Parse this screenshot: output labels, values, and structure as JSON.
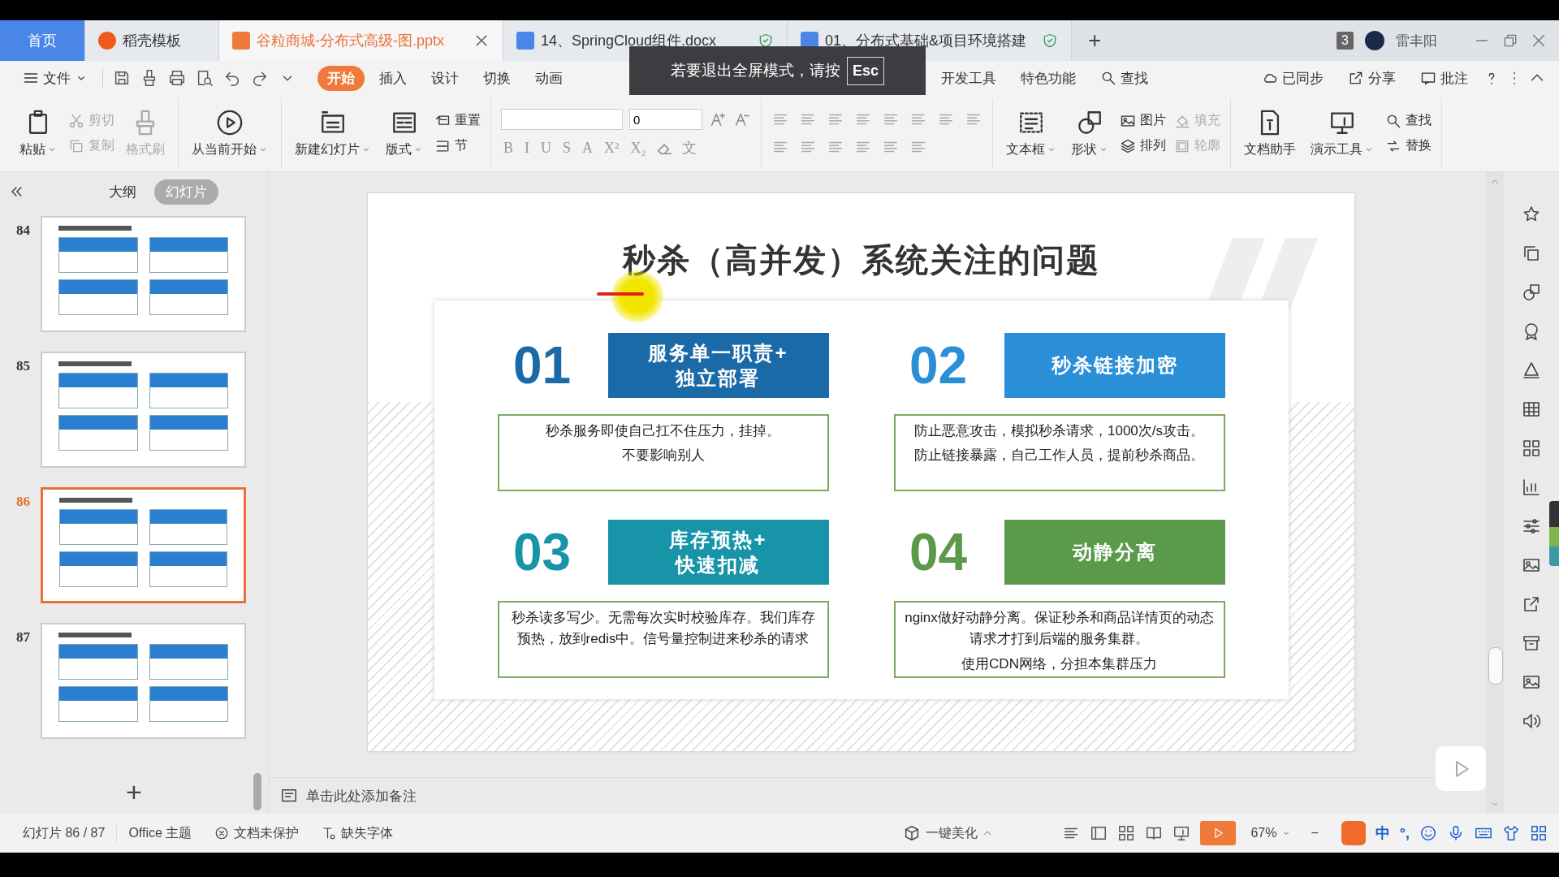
{
  "tabs": [
    {
      "label": "首页",
      "kind": "home",
      "selected": false
    },
    {
      "label": "稻壳模板",
      "kind": "docer",
      "selected": false
    },
    {
      "label": "谷粒商城-分布式高级-图.pptx",
      "kind": "ppt",
      "selected": true
    },
    {
      "label": "14、SpringCloud组件.docx",
      "kind": "word",
      "selected": false
    },
    {
      "label": "01、分布式基础&项目环境搭建",
      "kind": "word",
      "selected": false
    }
  ],
  "new_tab": "+",
  "window_count": "3",
  "user": "雷丰阳",
  "menu": {
    "file": "文件",
    "items": [
      {
        "label": "开始",
        "selected": true
      },
      {
        "label": "插入",
        "selected": false
      },
      {
        "label": "设计",
        "selected": false
      },
      {
        "label": "切换",
        "selected": false
      },
      {
        "label": "动画",
        "selected": false
      }
    ],
    "items_after": [
      {
        "label": "开发工具",
        "selected": false
      },
      {
        "label": "特色功能",
        "selected": false
      }
    ],
    "search": "查找",
    "actions": [
      "已同步",
      "分享",
      "批注"
    ]
  },
  "toast": {
    "text": "若要退出全屏模式，请按",
    "key": "Esc"
  },
  "ribbon": {
    "groups": [
      [
        {
          "kind": "large",
          "label": "粘贴",
          "dropdown": true,
          "disabled": false
        },
        {
          "kind": "stack",
          "items": [
            {
              "label": "剪切",
              "disabled": true
            },
            {
              "label": "复制",
              "disabled": true
            }
          ]
        },
        {
          "kind": "large",
          "label": "格式刷",
          "dropdown": false,
          "disabled": true
        }
      ],
      [
        {
          "kind": "large",
          "label": "从当前开始",
          "dropdown": true,
          "disabled": false
        }
      ],
      [
        {
          "kind": "large",
          "label": "新建幻灯片",
          "dropdown": true,
          "disabled": false
        },
        {
          "kind": "large",
          "label": "版式",
          "dropdown": true,
          "disabled": false
        },
        {
          "kind": "stack",
          "items": [
            {
              "label": "重置",
              "disabled": false
            },
            {
              "label": "节",
              "disabled": false
            }
          ]
        }
      ],
      [
        {
          "kind": "font",
          "size_value": "0",
          "format_buttons": [
            "B",
            "I",
            "U",
            "S",
            "A",
            "X²",
            "X₂",
            "文"
          ]
        }
      ],
      [
        {
          "kind": "paragraph"
        }
      ],
      [
        {
          "kind": "large",
          "label": "文本框",
          "dropdown": true,
          "disabled": false
        },
        {
          "kind": "large",
          "label": "形状",
          "dropdown": true,
          "disabled": false
        },
        {
          "kind": "stack",
          "items": [
            {
              "label": "图片",
              "disabled": false
            },
            {
              "label": "排列",
              "disabled": false
            }
          ]
        },
        {
          "kind": "stack",
          "items": [
            {
              "label": "填充",
              "disabled": true
            },
            {
              "label": "轮廓",
              "disabled": true
            }
          ]
        }
      ],
      [
        {
          "kind": "large",
          "label": "文档助手",
          "dropdown": false,
          "disabled": false
        },
        {
          "kind": "large",
          "label": "演示工具",
          "dropdown": true,
          "disabled": false
        },
        {
          "kind": "stack",
          "items": [
            {
              "label": "查找",
              "disabled": false
            },
            {
              "label": "替换",
              "disabled": false
            }
          ]
        }
      ]
    ]
  },
  "panel": {
    "views": [
      {
        "label": "大纲",
        "selected": false
      },
      {
        "label": "幻灯片",
        "selected": true
      }
    ],
    "slides": [
      {
        "number": "84",
        "selected": false
      },
      {
        "number": "85",
        "selected": false
      },
      {
        "number": "86",
        "selected": true
      },
      {
        "number": "87",
        "selected": false
      }
    ],
    "add": "+"
  },
  "slide": {
    "title": "秒杀（高并发）系统关注的问题",
    "cards": [
      {
        "number": "01",
        "heading": "服务单一职责+\n独立部署",
        "color": "#1b6aa8",
        "body": [
          "秒杀服务即使自己扛不住压力，挂掉。",
          "不要影响别人"
        ]
      },
      {
        "number": "02",
        "heading": "秒杀链接加密",
        "color": "#2b8fd8",
        "body": [
          "防止恶意攻击，模拟秒杀请求，1000次/s攻击。",
          "防止链接暴露，自己工作人员，提前秒杀商品。"
        ]
      },
      {
        "number": "03",
        "heading": "库存预热+\n快速扣减",
        "color": "#1794a8",
        "body": [
          "秒杀读多写少。无需每次实时校验库存。我们库存预热，放到redis中。信号量控制进来秒杀的请求"
        ]
      },
      {
        "number": "04",
        "heading": "动静分离",
        "color": "#5b9a4b",
        "body": [
          "nginx做好动静分离。保证秒杀和商品详情页的动态请求才打到后端的服务集群。",
          "使用CDN网络，分担本集群压力"
        ]
      }
    ]
  },
  "notes": "单击此处添加备注",
  "status_bar": {
    "slide": "幻灯片 86 / 87",
    "theme": "Office 主题",
    "protection": "文档未保护",
    "fonts": "缺失字体",
    "beautify": "一键美化",
    "zoom": "67%",
    "zoom_out": "−",
    "ime": [
      "中",
      "°,"
    ]
  }
}
